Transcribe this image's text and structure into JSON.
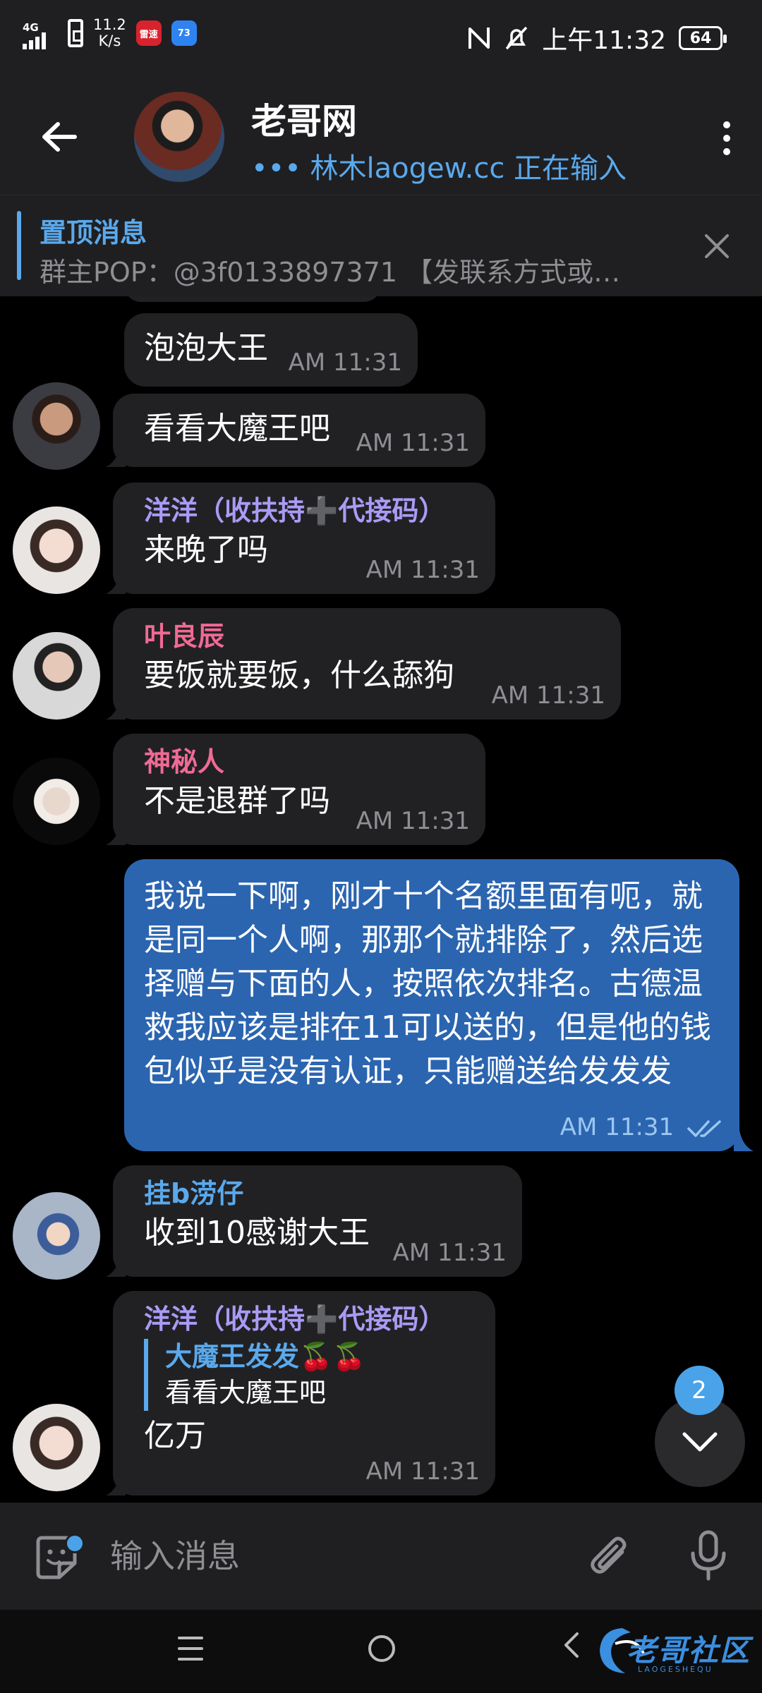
{
  "status_bar": {
    "network": "4G",
    "speed": "11.2\nK/s",
    "speed_top": "11.2",
    "speed_bottom": "K/s",
    "app1": "雷速",
    "app2": "73",
    "time": "上午11:32",
    "battery": "64"
  },
  "header": {
    "title": "老哥网",
    "subtitle": "••• 林木laogew.cc 正在输入"
  },
  "pinned": {
    "title": "置顶消息",
    "text": "群主POP：@3f0133897371 【发联系方式或…"
  },
  "messages": [
    {
      "text": "泡泡大王",
      "time": "AM 11:31"
    },
    {
      "text": "看看大魔王吧",
      "time": "AM 11:31"
    },
    {
      "sender": "洋洋（收扶持➕代接码）",
      "sender_color": "#a99bf5",
      "text": "来晚了吗",
      "time": "AM 11:31"
    },
    {
      "sender": "叶良辰",
      "sender_color": "#f06a94",
      "text": "要饭就要饭，什么舔狗",
      "time": "AM 11:31"
    },
    {
      "sender": "神秘人",
      "sender_color": "#f06a94",
      "text": "不是退群了吗",
      "time": "AM 11:31"
    },
    {
      "text": "我说一下啊，刚才十个名额里面有呃，就是同一个人啊，那那个就排除了，然后选择赠与下面的人，按照依次排名。古德温救我应该是排在11可以送的，但是他的钱包似乎是没有认证，只能赠送给发发发",
      "time": "AM 11:31",
      "outgoing": true
    },
    {
      "sender": "挂b涝仔",
      "sender_color": "#5aa9ec",
      "text": "收到10感谢大王",
      "time": "AM 11:31"
    },
    {
      "sender": "洋洋（收扶持➕代接码）",
      "sender_color": "#a99bf5",
      "reply_name": "大魔王发发🍒🍒",
      "reply_text": "看看大魔王吧",
      "text": "亿万",
      "time": "AM 11:31"
    }
  ],
  "scroll": {
    "unread_count": "2"
  },
  "composer": {
    "placeholder": "输入消息"
  },
  "watermark": {
    "text": "老哥社区",
    "sub": "LAOGESHEQU"
  },
  "colors": {
    "accent": "#5aa9ec",
    "outgoing_bubble": "#2b65b0",
    "incoming_bubble": "#212124",
    "background": "#000000"
  }
}
